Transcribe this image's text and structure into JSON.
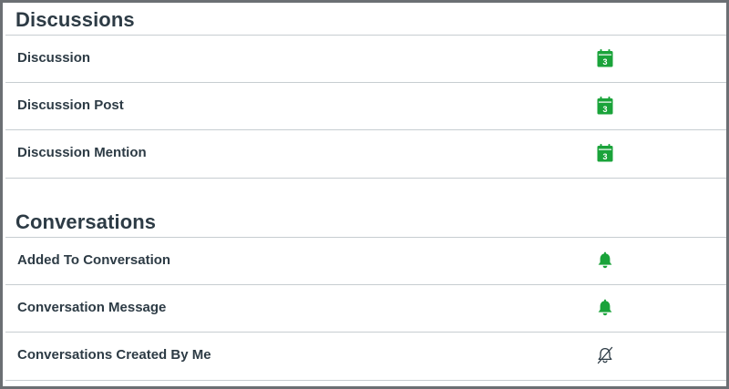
{
  "sections": [
    {
      "title": "Discussions",
      "rows": [
        {
          "label": "Discussion",
          "frequency_icon": "calendar-weekly-icon"
        },
        {
          "label": "Discussion Post",
          "frequency_icon": "calendar-weekly-icon"
        },
        {
          "label": "Discussion Mention",
          "frequency_icon": "calendar-weekly-icon"
        }
      ]
    },
    {
      "title": "Conversations",
      "rows": [
        {
          "label": "Added To Conversation",
          "frequency_icon": "bell-icon"
        },
        {
          "label": "Conversation Message",
          "frequency_icon": "bell-icon"
        },
        {
          "label": "Conversations Created By Me",
          "frequency_icon": "bell-off-icon"
        }
      ]
    }
  ],
  "calendar_icon_text": "3",
  "colors": {
    "accent_green": "#1aa33a",
    "text_dark": "#2d3b45",
    "muted_icon": "#2d3b45",
    "divider": "#c7cdd1"
  }
}
